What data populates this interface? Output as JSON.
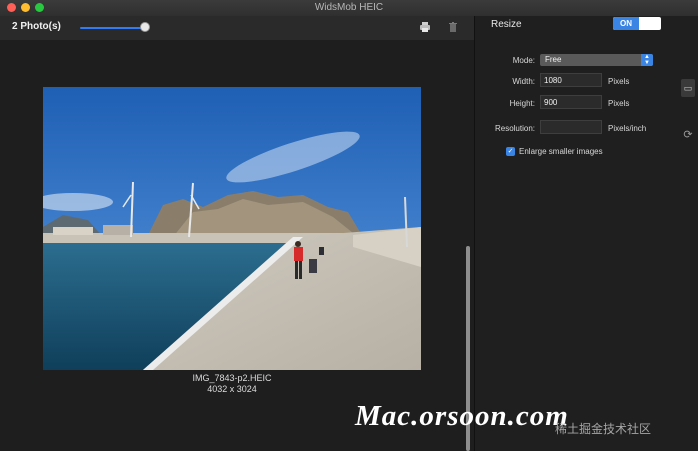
{
  "window": {
    "title": "WidsMob HEIC"
  },
  "toolbar": {
    "photos_count": "2 Photo(s)",
    "printer_icon": "printer-icon",
    "trash_icon": "trash-icon"
  },
  "photo": {
    "filename": "IMG_7843-p2.HEIC",
    "dimensions": "4032 x 3024"
  },
  "resize_panel": {
    "title": "Resize",
    "toggle_label": "ON",
    "mode_label": "Mode:",
    "mode_value": "Free",
    "width_label": "Width:",
    "width_value": "1080",
    "width_unit": "Pixels",
    "height_label": "Height:",
    "height_value": "900",
    "height_unit": "Pixels",
    "resolution_label": "Resolution:",
    "resolution_value": "",
    "resolution_unit": "Pixels/inch",
    "enlarge_label": "Enlarge smaller images",
    "enlarge_checked": true
  },
  "watermark": {
    "text": "Mac.orsoon.com",
    "secondary": "稀土掘金技术社区"
  },
  "colors": {
    "accent": "#3a85e4",
    "background": "#1e1e1e",
    "panel": "#1f1f1f"
  }
}
